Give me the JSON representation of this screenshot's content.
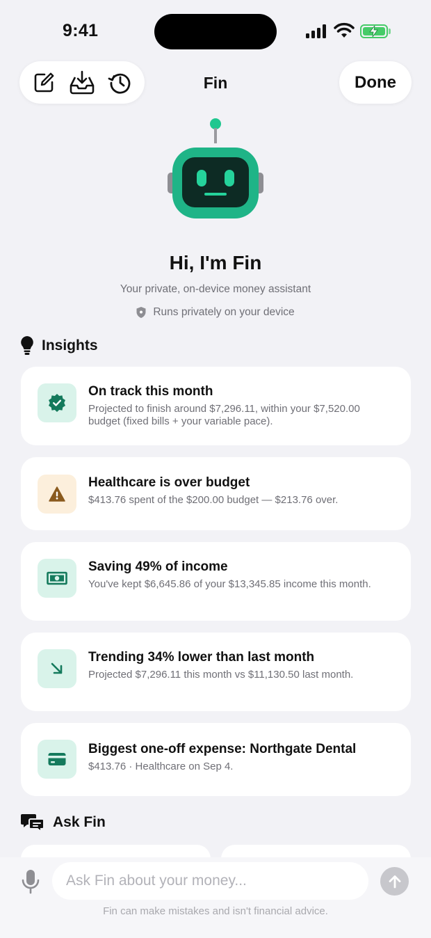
{
  "status_bar": {
    "time": "9:41"
  },
  "nav": {
    "title": "Fin",
    "done_label": "Done",
    "tool_icons": [
      "compose-icon",
      "inbox-download-icon",
      "history-icon"
    ]
  },
  "hero": {
    "greeting": "Hi, I'm Fin",
    "subtitle": "Your private, on-device money assistant",
    "privacy_note": "Runs privately on your device"
  },
  "insights": {
    "heading": "Insights",
    "items": [
      {
        "icon": "verified-check-icon",
        "title": "On track this month",
        "description": "Projected to finish around $7,296.11, within your $7,520.00 budget (fixed bills + your variable pace)."
      },
      {
        "icon": "warning-icon",
        "title": "Healthcare is over budget",
        "description": "$413.76 spent of the $200.00 budget — $213.76 over."
      },
      {
        "icon": "money-icon",
        "title": "Saving 49% of income",
        "description": "You've kept $6,645.86 of your $13,345.85 income this month."
      },
      {
        "icon": "trend-down-arrow-icon",
        "title": "Trending 34% lower than last month",
        "description": "Projected $7,296.11 this month vs $11,130.50 last month."
      },
      {
        "icon": "credit-card-icon",
        "title": "Biggest one-off expense: Northgate Dental",
        "description": "$413.76 · Healthcare on Sep 4."
      }
    ]
  },
  "ask": {
    "heading": "Ask Fin"
  },
  "composer": {
    "placeholder": "Ask Fin about your money...",
    "disclaimer": "Fin can make mistakes and isn't financial advice."
  },
  "colors": {
    "accent": "#1fb487",
    "accent_dark": "#0f7a5a",
    "warning": "#8a5a1e",
    "background": "#f2f2f6"
  }
}
